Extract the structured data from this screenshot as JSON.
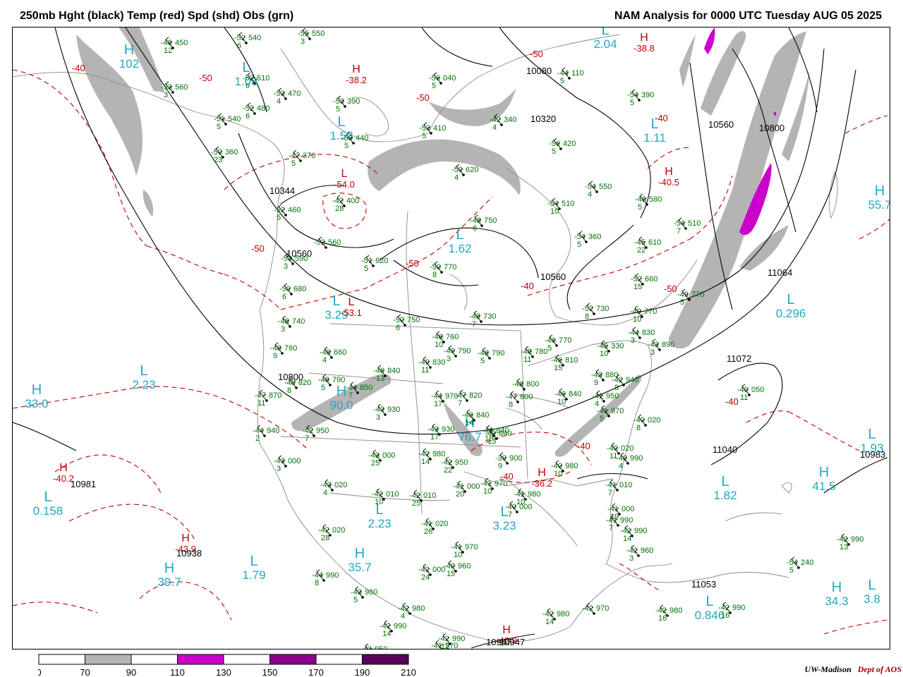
{
  "header": {
    "title_left": "250mb Hght (black) Temp (red) Spd (shd) Obs (grn)",
    "title_right": "NAM Analysis for 0000 UTC Tuesday  AUG 05 2025"
  },
  "legend": {
    "bins": [
      {
        "color": "#ffffff"
      },
      {
        "color": "#b4b4b4"
      },
      {
        "color": "#ffffff"
      },
      {
        "color": "#cc00cc"
      },
      {
        "color": "#ffffff"
      },
      {
        "color": "#8c008c"
      },
      {
        "color": "#ffffff"
      },
      {
        "color": "#5a005a"
      }
    ],
    "tick_labels": [
      "0",
      "70",
      "90",
      "110",
      "130",
      "150",
      "170",
      "190",
      "210"
    ]
  },
  "credit": {
    "org": "UW-Madison",
    "dept": "Dept of AOS"
  },
  "colors": {
    "height_contour": "#000000",
    "temperature_contour": "#c00000",
    "speed_shade": "#b4b4b4",
    "speed_shade_high": "#cc00cc",
    "observations": "#007000",
    "speed_center_labels": "#20a8c0",
    "map_lines": "#888888"
  },
  "height_labels": [
    "10800",
    "10560",
    "10344",
    "10080",
    "10320",
    "10560",
    "10560",
    "10800",
    "10981",
    "10938",
    "11064",
    "11072",
    "11040",
    "10983",
    "11053",
    "10947",
    "10947"
  ],
  "temperature_centers": [
    {
      "letter": "H",
      "value": "-38.2"
    },
    {
      "letter": "H",
      "value": "-40.2"
    },
    {
      "letter": "H",
      "value": "-43.9"
    },
    {
      "letter": "H",
      "value": "-42.9"
    },
    {
      "letter": "H",
      "value": "-38.8"
    },
    {
      "letter": "H",
      "value": "-40.5"
    },
    {
      "letter": "L",
      "value": "-53.1"
    },
    {
      "letter": "L",
      "value": "-54.0"
    },
    {
      "letter": "H",
      "value": "-36.2"
    }
  ],
  "temperature_contour_labels": [
    "-40",
    "-50",
    "-50",
    "-50",
    "-40",
    "-50",
    "-50",
    "-40",
    "-40",
    "-40",
    "-50",
    "-40"
  ],
  "speed_centers": [
    {
      "letter": "H",
      "value": "102"
    },
    {
      "letter": "L",
      "value": "2.04"
    },
    {
      "letter": "L",
      "value": "1.08"
    },
    {
      "letter": "L",
      "value": "1.53"
    },
    {
      "letter": "L",
      "value": "1.62"
    },
    {
      "letter": "L",
      "value": "3.29"
    },
    {
      "letter": "L",
      "value": "2.23"
    },
    {
      "letter": "H",
      "value": "33.0"
    },
    {
      "letter": "L",
      "value": "0.158"
    },
    {
      "letter": "H",
      "value": "39.7"
    },
    {
      "letter": "L",
      "value": "1.79"
    },
    {
      "letter": "H",
      "value": "35.7"
    },
    {
      "letter": "L",
      "value": "2.23"
    },
    {
      "letter": "L",
      "value": "3.23"
    },
    {
      "letter": "L",
      "value": "1.82"
    },
    {
      "letter": "H",
      "value": "41.5"
    },
    {
      "letter": "L",
      "value": "0.296"
    },
    {
      "letter": "L",
      "value": "1.11"
    },
    {
      "letter": "H",
      "value": "55.7"
    },
    {
      "letter": "H",
      "value": "34.3"
    },
    {
      "letter": "L",
      "value": "0.846"
    },
    {
      "letter": "L",
      "value": "3.8"
    },
    {
      "letter": "H",
      "value": "90.0"
    },
    {
      "letter": "H",
      "value": "76.7"
    },
    {
      "letter": "L",
      "value": "1.93"
    }
  ],
  "observations": [
    {
      "temp": "-48",
      "height": "450",
      "dp": "12"
    },
    {
      "temp": "-52",
      "height": "540",
      "dp": "6"
    },
    {
      "temp": "-55",
      "height": "550",
      "dp": "3"
    },
    {
      "temp": "-53",
      "height": "560",
      "dp": "3"
    },
    {
      "temp": "-52",
      "height": "510",
      "dp": "6"
    },
    {
      "temp": "-53",
      "height": "470",
      "dp": "4"
    },
    {
      "temp": "-52",
      "height": "480",
      "dp": "6"
    },
    {
      "temp": "-51",
      "height": "540",
      "dp": "5"
    },
    {
      "temp": "-53",
      "height": "390",
      "dp": "5"
    },
    {
      "temp": "-55",
      "height": "440",
      "dp": "5"
    },
    {
      "temp": "-50",
      "height": "360",
      "dp": "23"
    },
    {
      "temp": "-47",
      "height": "370",
      "dp": "5"
    },
    {
      "temp": "-42",
      "height": "400",
      "dp": "28"
    },
    {
      "temp": "-52",
      "height": "460",
      "dp": "5"
    },
    {
      "temp": "-52",
      "height": "560",
      "dp": ""
    },
    {
      "temp": "-51",
      "height": "620",
      "dp": "5"
    },
    {
      "temp": "-53",
      "height": "410",
      "dp": "5"
    },
    {
      "temp": "-50",
      "height": "620",
      "dp": "4"
    },
    {
      "temp": "-48",
      "height": "750",
      "dp": "6"
    },
    {
      "temp": "-50",
      "height": "770",
      "dp": "8"
    },
    {
      "temp": "-53",
      "height": "590",
      "dp": "3"
    },
    {
      "temp": "-50",
      "height": "680",
      "dp": "6"
    },
    {
      "temp": "-48",
      "height": "740",
      "dp": "3"
    },
    {
      "temp": "-48",
      "height": "760",
      "dp": "9"
    },
    {
      "temp": "-48",
      "height": "660",
      "dp": "4"
    },
    {
      "temp": "-50",
      "height": "750",
      "dp": "6"
    },
    {
      "temp": "-48",
      "height": "760",
      "dp": "10"
    },
    {
      "temp": "-49",
      "height": "790",
      "dp": "3"
    },
    {
      "temp": "-48",
      "height": "790",
      "dp": "5"
    },
    {
      "temp": "-48",
      "height": "780",
      "dp": "11"
    },
    {
      "temp": "-46",
      "height": "770",
      "dp": "5"
    },
    {
      "temp": "-46",
      "height": "810",
      "dp": "15"
    },
    {
      "temp": "-46",
      "height": "840",
      "dp": "13"
    },
    {
      "temp": "-49",
      "height": "830",
      "dp": "11"
    },
    {
      "temp": "-48",
      "height": "790",
      "dp": "5"
    },
    {
      "temp": "-48",
      "height": "820",
      "dp": "8"
    },
    {
      "temp": "-47",
      "height": "870",
      "dp": "11"
    },
    {
      "temp": "-44",
      "height": "850",
      "dp": "7"
    },
    {
      "temp": "-43",
      "height": "930",
      "dp": "3"
    },
    {
      "temp": "-44",
      "height": "970",
      "dp": "17"
    },
    {
      "temp": "-47",
      "height": "820",
      "dp": "7"
    },
    {
      "temp": "-46",
      "height": "840",
      "dp": "14"
    },
    {
      "temp": "-43",
      "height": "840",
      "dp": "18"
    },
    {
      "temp": "-48",
      "height": "800",
      "dp": ""
    },
    {
      "temp": "-47",
      "height": "800",
      "dp": "8"
    },
    {
      "temp": "-46",
      "height": "840",
      "dp": "10"
    },
    {
      "temp": "-43",
      "height": "880",
      "dp": "9"
    },
    {
      "temp": "-42",
      "height": "940",
      "dp": "8"
    },
    {
      "temp": "-45",
      "height": "330",
      "dp": "10"
    },
    {
      "temp": "-44",
      "height": "830",
      "dp": "3"
    },
    {
      "temp": "-43",
      "height": "890",
      "dp": "3"
    },
    {
      "temp": "-44",
      "height": "940",
      "dp": "2"
    },
    {
      "temp": "-42",
      "height": "950",
      "dp": "7"
    },
    {
      "temp": "-43",
      "height": "000",
      "dp": "3"
    },
    {
      "temp": "-43",
      "height": "000",
      "dp": "25"
    },
    {
      "temp": "-42",
      "height": "980",
      "dp": "14"
    },
    {
      "temp": "-42",
      "height": "950",
      "dp": "22"
    },
    {
      "temp": "-43",
      "height": "930",
      "dp": "17"
    },
    {
      "temp": "-43",
      "height": "840",
      "dp": "13"
    },
    {
      "temp": "-39",
      "height": "900",
      "dp": "9"
    },
    {
      "temp": "-40",
      "height": "980",
      "dp": "10"
    },
    {
      "temp": "-40",
      "height": "990",
      "dp": "4"
    },
    {
      "temp": "-41",
      "height": "950",
      "dp": "4"
    },
    {
      "temp": "-41",
      "height": "970",
      "dp": "5"
    },
    {
      "temp": "-40",
      "height": "020",
      "dp": "8"
    },
    {
      "temp": "-40",
      "height": "020",
      "dp": "11"
    },
    {
      "temp": "-40",
      "height": "050",
      "dp": "11"
    },
    {
      "temp": "-43",
      "height": "020",
      "dp": "4"
    },
    {
      "temp": "-42",
      "height": "010",
      "dp": "10"
    },
    {
      "temp": "-42",
      "height": "010",
      "dp": "25"
    },
    {
      "temp": "-41",
      "height": "000",
      "dp": "20"
    },
    {
      "temp": "-41",
      "height": "970",
      "dp": "10"
    },
    {
      "temp": "-41",
      "height": "980",
      "dp": "10"
    },
    {
      "temp": "-40",
      "height": "000",
      "dp": "7"
    },
    {
      "temp": "-41",
      "height": "010",
      "dp": "7"
    },
    {
      "temp": "-41",
      "height": "000",
      "dp": "19"
    },
    {
      "temp": "-41",
      "height": "990",
      "dp": "7"
    },
    {
      "temp": "-42",
      "height": "990",
      "dp": "14"
    },
    {
      "temp": "-42",
      "height": "960",
      "dp": "3"
    },
    {
      "temp": "-41",
      "height": "020",
      "dp": "26"
    },
    {
      "temp": "-41",
      "height": "970",
      "dp": "10"
    },
    {
      "temp": "-42",
      "height": "020",
      "dp": "28"
    },
    {
      "temp": "-42",
      "height": "000",
      "dp": "24"
    },
    {
      "temp": "-40",
      "height": "960",
      "dp": "15"
    },
    {
      "temp": "-44",
      "height": "990",
      "dp": "8"
    },
    {
      "temp": "-43",
      "height": "980",
      "dp": "5"
    },
    {
      "temp": "-42",
      "height": "980",
      "dp": "4"
    },
    {
      "temp": "-42",
      "height": "990",
      "dp": "14"
    },
    {
      "temp": "-42",
      "height": "990",
      "dp": "12"
    },
    {
      "temp": "-42",
      "height": "980",
      "dp": "14"
    },
    {
      "temp": "-42",
      "height": "970",
      "dp": ""
    },
    {
      "temp": "-43",
      "height": "950",
      "dp": ""
    },
    {
      "temp": "-41",
      "height": "970",
      "dp": "13"
    },
    {
      "temp": "-42",
      "height": "980",
      "dp": "16"
    },
    {
      "temp": "-42",
      "height": "990",
      "dp": "16"
    },
    {
      "temp": "-42",
      "height": "990",
      "dp": "13"
    },
    {
      "temp": "-54",
      "height": "240",
      "dp": "5"
    },
    {
      "temp": "-54",
      "height": "390",
      "dp": "5"
    },
    {
      "temp": "-56",
      "height": "420",
      "dp": "5"
    },
    {
      "temp": "-54",
      "height": "550",
      "dp": "4"
    },
    {
      "temp": "-54",
      "height": "510",
      "dp": "10"
    },
    {
      "temp": "-54",
      "height": "360",
      "dp": "5"
    },
    {
      "temp": "-48",
      "height": "580",
      "dp": "5"
    },
    {
      "temp": "-54",
      "height": "510",
      "dp": "7"
    },
    {
      "temp": "-45",
      "height": "610",
      "dp": "22"
    },
    {
      "temp": "-52",
      "height": "660",
      "dp": "15"
    },
    {
      "temp": "-49",
      "height": "770",
      "dp": "5"
    },
    {
      "temp": "-49",
      "height": "770",
      "dp": "10"
    },
    {
      "temp": "-52",
      "height": "730",
      "dp": "8"
    },
    {
      "temp": "-48",
      "height": "730",
      "dp": "7"
    },
    {
      "temp": "-44",
      "height": "110",
      "dp": "5"
    },
    {
      "temp": "-56",
      "height": "040",
      "dp": "5"
    },
    {
      "temp": "-42",
      "height": "340",
      "dp": "4"
    }
  ]
}
